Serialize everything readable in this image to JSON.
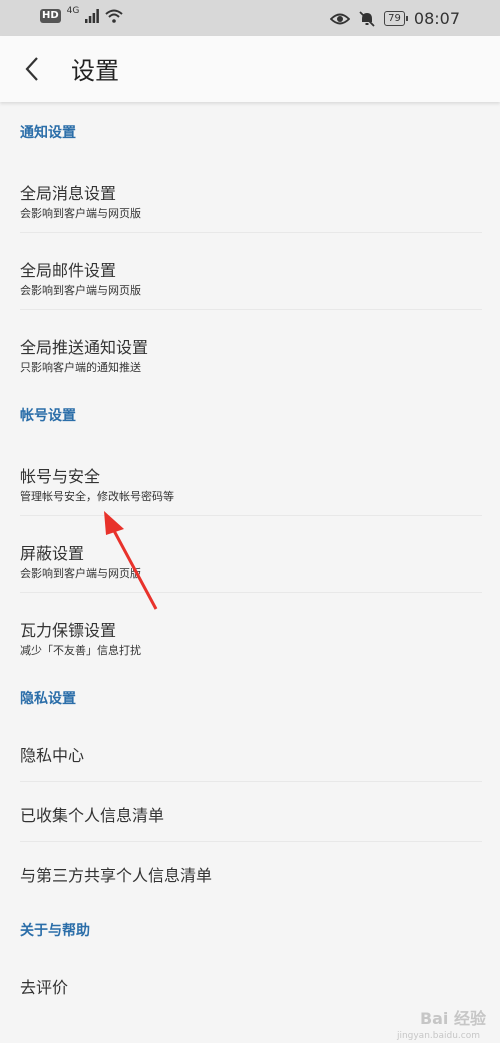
{
  "status_bar": {
    "network": "4G",
    "hd": "HD",
    "battery": "79",
    "time": "08:07"
  },
  "header": {
    "title": "设置"
  },
  "sections": [
    {
      "title": "通知设置",
      "items": [
        {
          "title": "全局消息设置",
          "subtitle": "会影响到客户端与网页版"
        },
        {
          "title": "全局邮件设置",
          "subtitle": "会影响到客户端与网页版"
        },
        {
          "title": "全局推送通知设置",
          "subtitle": "只影响客户端的通知推送"
        }
      ]
    },
    {
      "title": "帐号设置",
      "items": [
        {
          "title": "帐号与安全",
          "subtitle": "管理帐号安全，修改帐号密码等"
        },
        {
          "title": "屏蔽设置",
          "subtitle": "会影响到客户端与网页版"
        },
        {
          "title": "瓦力保镖设置",
          "subtitle": "减少「不友善」信息打扰"
        }
      ]
    },
    {
      "title": "隐私设置",
      "items": [
        {
          "title": "隐私中心"
        },
        {
          "title": "已收集个人信息清单"
        },
        {
          "title": "与第三方共享个人信息清单"
        }
      ]
    },
    {
      "title": "关于与帮助",
      "items": [
        {
          "title": "去评价"
        }
      ]
    }
  ],
  "watermark": {
    "text": "Bai 经验",
    "sub": "jingyan.baidu.com"
  },
  "colors": {
    "accent": "#2b6ea9",
    "arrow": "#e8322b"
  }
}
